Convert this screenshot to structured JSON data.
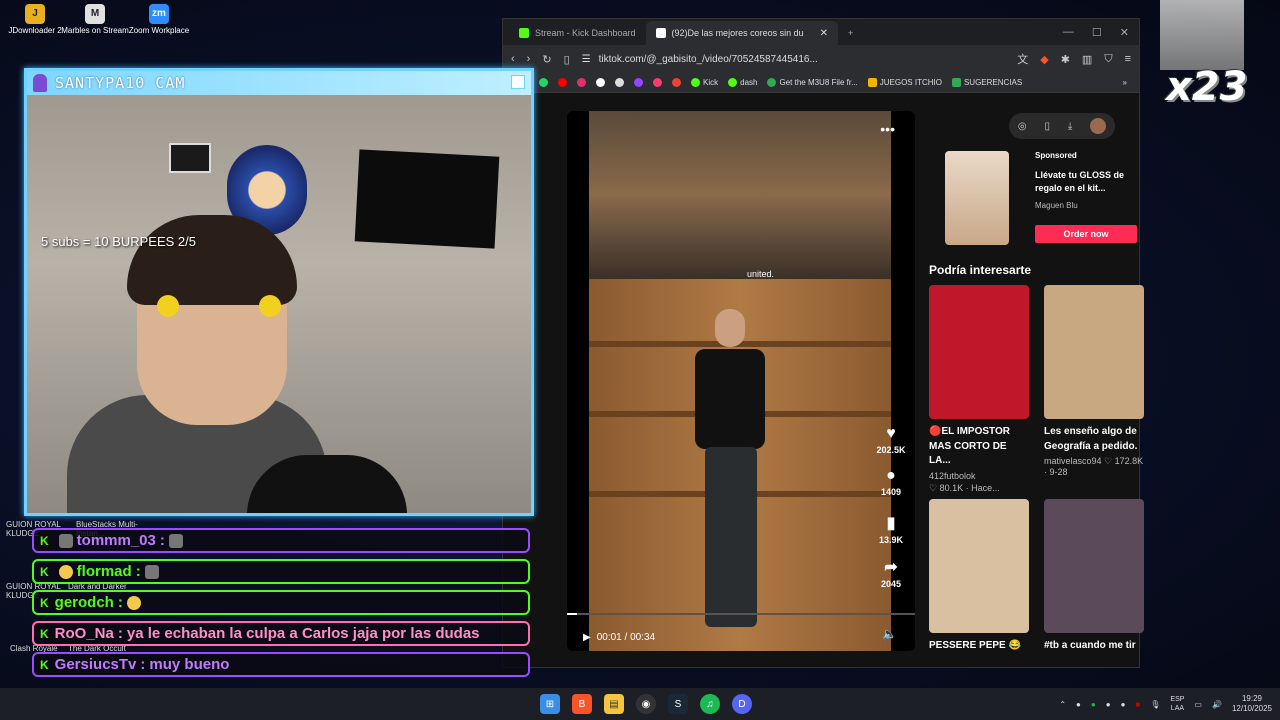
{
  "desktop": {
    "icons": [
      {
        "label": "JDownloader 2",
        "glyph": "J",
        "color": "#e8b020"
      },
      {
        "label": "Marbles on Stream",
        "glyph": "M",
        "color": "#e0e0e0"
      },
      {
        "label": "Zoom Workplace",
        "glyph": "zm",
        "color": "#2d8cff"
      }
    ],
    "game_labels": [
      {
        "label": "GUION ROYAL KLUDGE"
      },
      {
        "label": "BlueStacks Multi-Instan..."
      },
      {
        "label": "GUION ROYAL KLUDGE"
      },
      {
        "label": "Dark and Darker"
      },
      {
        "label": "Clash Royale"
      },
      {
        "label": "The Dark Occult"
      }
    ]
  },
  "cam": {
    "title": "SANTYPA10  CAM",
    "overlay_text": "5 subs = 10 BURPEES 2/5"
  },
  "chat": [
    {
      "user": "tommm_03",
      "message": "",
      "border": "#9a4dff",
      "color": "#c07bff"
    },
    {
      "user": "flormad",
      "message": "",
      "border": "#53fc18",
      "color": "#53fc18"
    },
    {
      "user": "gerodch",
      "message": "",
      "border": "#53fc18",
      "color": "#53fc18"
    },
    {
      "user": "RoO_Na",
      "message": "ya le echaban la culpa a Carlos jaja por las dudas",
      "border": "#ff6fb0",
      "color": "#ff8fc8"
    },
    {
      "user": "GersiucsTv",
      "message": "muy bueno",
      "border": "#9a4dff",
      "color": "#c07bff"
    }
  ],
  "browser": {
    "tabs": [
      {
        "title": "Stream - Kick Dashboard",
        "fav": "#53fc18"
      },
      {
        "title": "(92)De las mejores coreos sin du",
        "fav": "#ffffff"
      }
    ],
    "new_tab": "+",
    "url": "tiktok.com/@_gabisito_/video/70524587445416...",
    "bookmarks": [
      {
        "label": "",
        "color": "#25d366"
      },
      {
        "label": "",
        "color": "#ff0000"
      },
      {
        "label": "",
        "color": "#e1306c"
      },
      {
        "label": "",
        "color": "#ffffff"
      },
      {
        "label": "",
        "color": "#ffffff"
      },
      {
        "label": "",
        "color": "#9146ff"
      },
      {
        "label": "",
        "color": "#ff3b6b"
      },
      {
        "label": "",
        "color": "#ea4335"
      },
      {
        "label": "Kick",
        "color": "#53fc18"
      },
      {
        "label": "dash",
        "color": "#53fc18"
      },
      {
        "label": "Get the M3U8 File fr...",
        "color": "#34a853"
      },
      {
        "label": "JUEGOS ITCHIO",
        "color": "#f5b400"
      },
      {
        "label": "SUGERENCIAS",
        "color": "#34a853"
      }
    ]
  },
  "video": {
    "caption": "united.",
    "time": "00:01 / 00:34",
    "progress": 0.03,
    "likes": "202.5K",
    "comments": "1409",
    "saves": "13.9K",
    "shares": "2045"
  },
  "ad": {
    "sponsored": "Sponsored",
    "title": "Llévate tu GLOSS de regalo en el kit...",
    "brand": "Maguen Blu",
    "button": "Order now"
  },
  "recommendations": {
    "heading": "Podría interesarte",
    "cards": [
      {
        "title": "🔴EL IMPOSTOR MAS CORTO DE LA...",
        "author": "412futbolok",
        "meta": "♡ 80.1K · Hace...",
        "color": "#c0182a"
      },
      {
        "title": "Les enseño algo de Geografía a pedido.",
        "author": "",
        "meta": "mativelasco94 ♡ 172.8K · 9-28",
        "color": "#c8a880"
      },
      {
        "title": "PESSERE PEPE 😂",
        "author": "",
        "meta": "",
        "color": "#d8c0a0"
      },
      {
        "title": "#tb a cuando me tir",
        "author": "",
        "meta": "",
        "color": "#5a4a5a"
      }
    ]
  },
  "overlay": {
    "counter": "x23"
  },
  "taskbar": {
    "lang": "ESP",
    "lang2": "LAA",
    "time": "19:29",
    "date": "12/10/2025"
  }
}
